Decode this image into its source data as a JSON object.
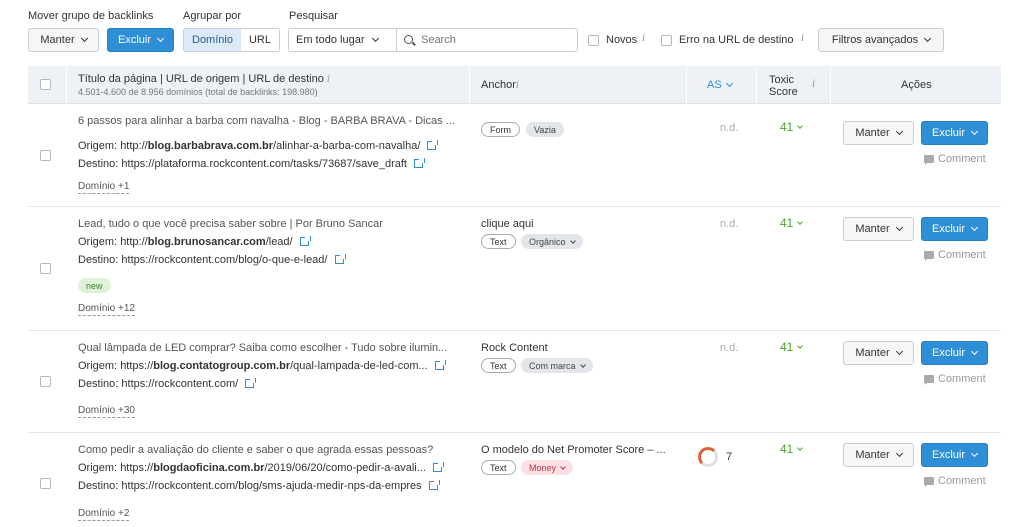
{
  "toolbar": {
    "move_group_label": "Mover grupo de backlinks",
    "keep_label": "Manter",
    "delete_label": "Excluir",
    "group_by_label": "Agrupar por",
    "group_options": [
      "Domínio",
      "URL"
    ],
    "group_selected": "Domínio",
    "search_label": "Pesquisar",
    "search_scope": "Em todo lugar",
    "search_placeholder": "Search",
    "new_label": "Novos",
    "target_error_label": "Erro na URL de destino",
    "advanced_filters_label": "Filtros avançados"
  },
  "table": {
    "header": {
      "title_col": "Título da página | URL de origem | URL de destino",
      "title_sub": "4.501-4.600 de 8.956 domínios (total de backlinks: 198.980)",
      "anchor_col": "Anchor",
      "as_col": "AS",
      "toxic_col_line1": "Toxic",
      "toxic_col_line2": "Score",
      "actions_col": "Ações"
    },
    "origin_prefix": "Origem:",
    "dest_prefix": "Destino:",
    "comment_label": "Comment",
    "keep_label": "Manter",
    "delete_label": "Excluir",
    "rows": [
      {
        "title": "6 passos para alinhar a barba com navalha - Blog - BARBA BRAVA - Dicas ...",
        "origin_scheme": "http://",
        "origin_domain": "blog.barbabrava.com.br",
        "origin_path": "/alinhar-a-barba-com-navalha/",
        "dest": "https://plataforma.rockcontent.com/tasks/73687/save_draft",
        "domain_more": "Domínio +1",
        "anchor_text": "",
        "tag1": "Form",
        "tag2": "Vazia",
        "as": "n.d.",
        "toxic": "41"
      },
      {
        "title": "Lead, tudo o que você precisa saber sobre | Por Bruno Sancar",
        "origin_scheme": "http://",
        "origin_domain": "blog.brunosancar.com",
        "origin_path": "/lead/",
        "dest": "https://rockcontent.com/blog/o-que-e-lead/",
        "badge": "new",
        "domain_more": "Domínio +12",
        "anchor_text": "clique aqui",
        "tag1": "Text",
        "tag2": "Orgânico",
        "as": "n.d.",
        "toxic": "41"
      },
      {
        "title": "Qual lâmpada de LED comprar? Saiba como escolher - Tudo sobre ilumin...",
        "origin_scheme": "https://",
        "origin_domain": "blog.contatogroup.com.br",
        "origin_path": "/qual-lampada-de-led-com...",
        "dest": "https://rockcontent.com/",
        "domain_more": "Domínio +30",
        "anchor_text": "Rock Content",
        "tag1": "Text",
        "tag2": "Com marca",
        "as": "n.d.",
        "toxic": "41"
      },
      {
        "title": "Como pedir a avaliação do cliente e saber o que agrada essas pessoas?",
        "origin_scheme": "https://",
        "origin_domain": "blogdaoficina.com.br",
        "origin_path": "/2019/06/20/como-pedir-a-avali...",
        "dest": "https://rockcontent.com/blog/sms-ajuda-medir-nps-da-empres",
        "domain_more": "Domínio +2",
        "anchor_text": "O modelo do Net Promoter Score – ...",
        "tag1": "Text",
        "tag2": "Money",
        "as": "7",
        "toxic": "41"
      }
    ]
  },
  "colors": {
    "primary": "#2e8fd6",
    "toxic_green": "#4aa52b",
    "money_pink": "#c4304a"
  }
}
